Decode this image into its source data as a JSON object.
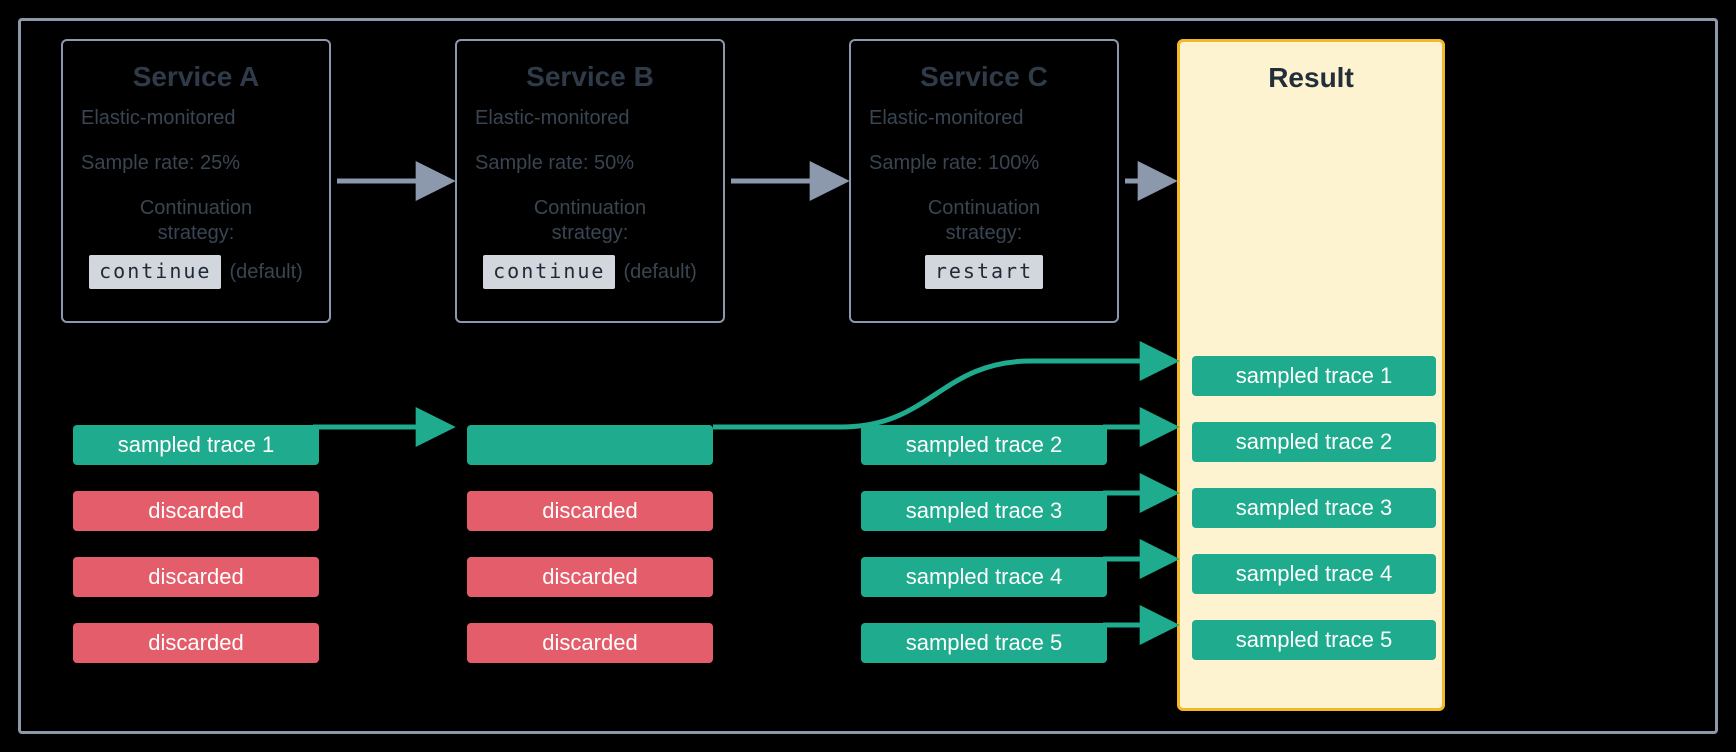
{
  "services": {
    "a": {
      "title": "Service A",
      "monitored": "Elastic-monitored",
      "sample_rate": "Sample rate: 25%",
      "strategy_label1": "Continuation",
      "strategy_label2": "strategy:",
      "code": "continue",
      "default": "(default)"
    },
    "b": {
      "title": "Service B",
      "monitored": "Elastic-monitored",
      "sample_rate": "Sample rate: 50%",
      "strategy_label1": "Continuation",
      "strategy_label2": "strategy:",
      "code": "continue",
      "default": "(default)"
    },
    "c": {
      "title": "Service C",
      "monitored": "Elastic-monitored",
      "sample_rate": "Sample rate: 100%",
      "strategy_label1": "Continuation",
      "strategy_label2": "strategy:",
      "code": "restart",
      "default": ""
    }
  },
  "result_title": "Result",
  "stacks": {
    "a": [
      {
        "label": "sampled trace 1",
        "cls": "green"
      },
      {
        "label": "discarded",
        "cls": "red"
      },
      {
        "label": "discarded",
        "cls": "red"
      },
      {
        "label": "discarded",
        "cls": "red"
      }
    ],
    "b": [
      {
        "label": "",
        "cls": "green"
      },
      {
        "label": "discarded",
        "cls": "red"
      },
      {
        "label": "discarded",
        "cls": "red"
      },
      {
        "label": "discarded",
        "cls": "red"
      }
    ],
    "c": [
      {
        "label": "sampled trace 2",
        "cls": "green"
      },
      {
        "label": "sampled trace 3",
        "cls": "green"
      },
      {
        "label": "sampled trace 4",
        "cls": "green"
      },
      {
        "label": "sampled trace 5",
        "cls": "green"
      }
    ],
    "r": [
      {
        "label": "sampled trace 1",
        "cls": "green"
      },
      {
        "label": "sampled trace 2",
        "cls": "green"
      },
      {
        "label": "sampled trace 3",
        "cls": "green"
      },
      {
        "label": "sampled trace 4",
        "cls": "green"
      },
      {
        "label": "sampled trace 5",
        "cls": "green"
      }
    ]
  },
  "colors": {
    "teal": "#1fab8d",
    "grey": "#8c98ab"
  }
}
